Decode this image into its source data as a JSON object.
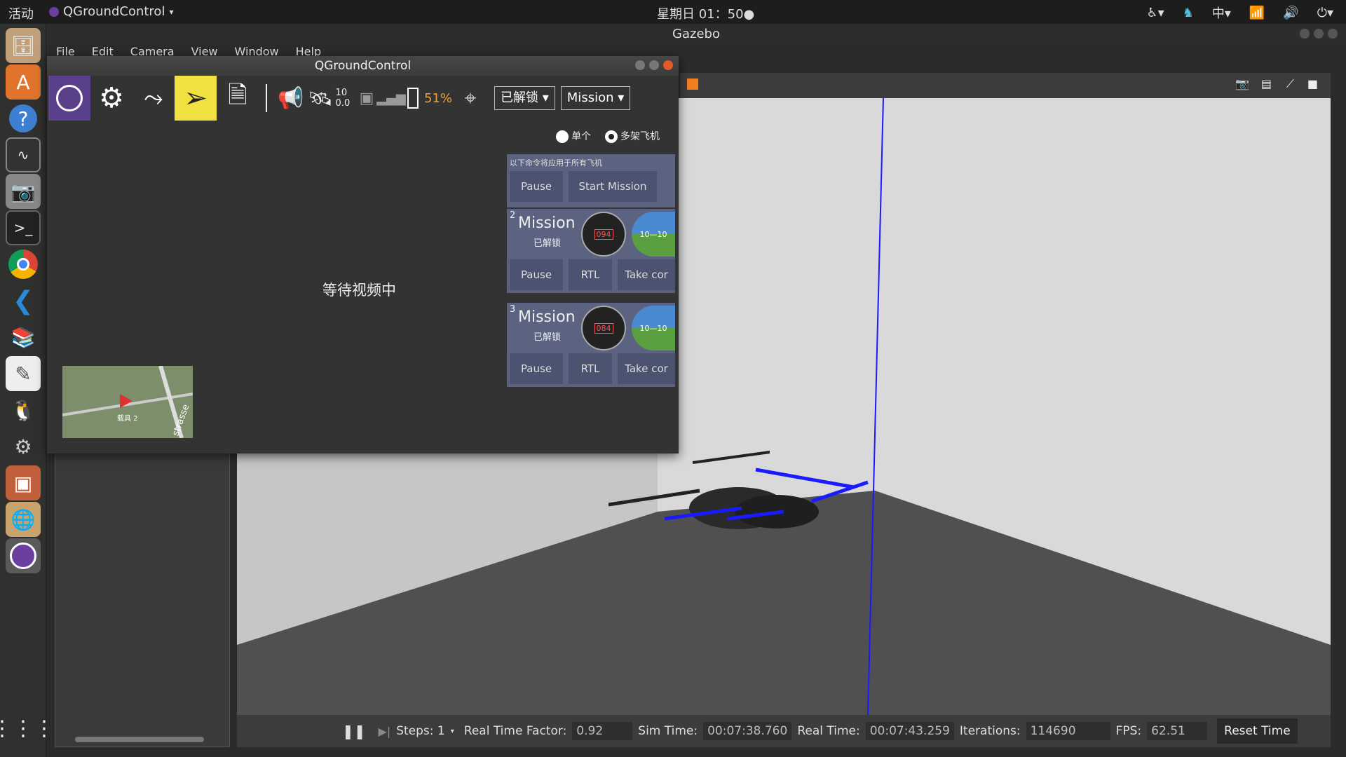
{
  "topbar": {
    "activities": "活动",
    "app": "QGroundControl",
    "clock": "星期日 01：50●",
    "input_method": "中"
  },
  "gazebo": {
    "title": "Gazebo",
    "menu": [
      "File",
      "Edit",
      "Camera",
      "View",
      "Window",
      "Help"
    ],
    "bottom": {
      "steps": "Steps: 1",
      "rtf_label": "Real Time Factor:",
      "rtf": "0.92",
      "sim_label": "Sim Time:",
      "sim": "00:07:38.760",
      "real_label": "Real Time:",
      "real": "00:07:43.259",
      "iter_label": "Iterations:",
      "iter": "114690",
      "fps_label": "FPS:",
      "fps": "62.51",
      "reset": "Reset Time"
    }
  },
  "qgc": {
    "title": "QGroundControl",
    "sat_count": "10",
    "hdop": "0.0",
    "battery": "51%",
    "arm_state": "已解锁",
    "flight_mode": "Mission",
    "radio_single": "单个",
    "radio_multi": "多架飞机",
    "waiting": "等待视频中",
    "map_label": "载具 2",
    "map_street": "strasse",
    "all_panel": {
      "note": "以下命令将应用于所有飞机",
      "pause": "Pause",
      "start": "Start Mission"
    },
    "vehicles": [
      {
        "id": "2",
        "mode": "Mission",
        "state": "已解锁",
        "heading": "094",
        "att": "10—10",
        "pause": "Pause",
        "rtl": "RTL",
        "take": "Take cor"
      },
      {
        "id": "3",
        "mode": "Mission",
        "state": "已解锁",
        "heading": "084",
        "att": "10—10",
        "pause": "Pause",
        "rtl": "RTL",
        "take": "Take cor"
      }
    ]
  }
}
